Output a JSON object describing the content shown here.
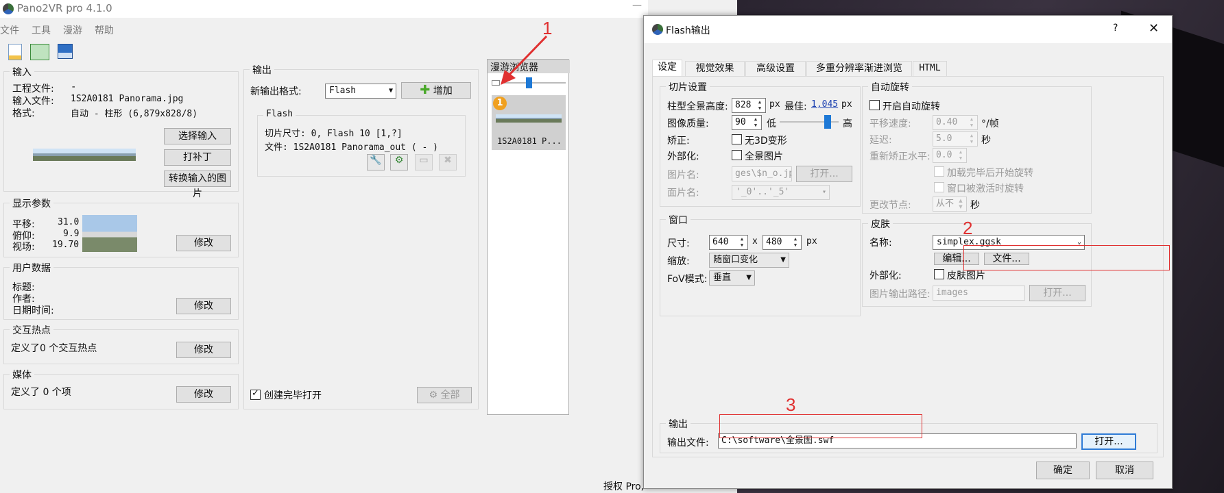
{
  "main_window": {
    "title": "Pano2VR pro 4.1.0",
    "menu": [
      "文件",
      "工具",
      "漫游",
      "帮助"
    ],
    "input_group": {
      "title": "输入",
      "project_file_label": "工程文件:",
      "project_file_value": "-",
      "input_file_label": "输入文件:",
      "input_file_value": "1S2A0181 Panorama.jpg",
      "format_label": "格式:",
      "format_value": "自动 - 柱形 (6,879x828/8)",
      "select_input_btn": "选择输入",
      "patch_btn": "打补丁",
      "convert_btn": "转换输入的图片"
    },
    "display_group": {
      "title": "显示参数",
      "pan_label": "平移:",
      "pan_value": "31.0",
      "tilt_label": "俯仰:",
      "tilt_value": "9.9",
      "fov_label": "视场:",
      "fov_value": "19.70",
      "modify_btn": "修改"
    },
    "userdata_group": {
      "title": "用户数据",
      "title_label": "标题:",
      "author_label": "作者:",
      "date_label": "日期时间:",
      "modify_btn": "修改"
    },
    "hotspot_group": {
      "title": "交互热点",
      "text": "定义了0 个交互热点",
      "modify_btn": "修改"
    },
    "media_group": {
      "title": "媒体",
      "text": "定义了 0 个项",
      "modify_btn": "修改"
    },
    "output_group": {
      "title": "输出",
      "new_format_label": "新输出格式:",
      "format_select": "Flash",
      "add_btn": "增加",
      "flash_title": "Flash",
      "tile_size": "切片尺寸: 0, Flash 10 [1,?]",
      "file_text": "文件: 1S2A0181 Panorama_out ( - )",
      "open_after_label": "创建完毕打开",
      "all_btn": "全部"
    },
    "browser": {
      "title": "漫游浏览器",
      "badge": "1",
      "item_label": "1S2A0181 P..."
    },
    "license_text": "授权 Pro,"
  },
  "dialog": {
    "title": "Flash输出",
    "help_btn": "?",
    "close_btn": "✕",
    "tabs": [
      "设定",
      "视觉效果",
      "高级设置",
      "多重分辨率渐进浏览",
      "HTML"
    ],
    "tile_group": {
      "title": "切片设置",
      "height_label": "柱型全景高度:",
      "height_value": "828",
      "px": "px",
      "best_label": "最佳:",
      "best_value": "1,045",
      "quality_label": "图像质量:",
      "quality_value": "90",
      "low": "低",
      "high": "高",
      "quality_level": 0.85,
      "correct_label": "矫正:",
      "no3d_label": "无3D变形",
      "external_label": "外部化:",
      "pano_image_label": "全景图片",
      "image_name_label": "图片名:",
      "image_name_value": "ges\\$n_o.jpg",
      "open_btn": "打开...",
      "face_name_label": "面片名:",
      "face_name_value": "'_0'..'_5'"
    },
    "autorotate_group": {
      "title": "自动旋转",
      "enable_label": "开启自动旋转",
      "speed_label": "平移速度:",
      "speed_value": "0.40",
      "speed_unit": "°/帧",
      "delay_label": "延迟:",
      "delay_value": "5.0",
      "delay_unit": "秒",
      "level_label": "重新矫正水平:",
      "level_value": "0.0",
      "after_load_label": "加载完毕后开始旋转",
      "activate_label": "窗口被激活时旋转",
      "change_node_label": "更改节点:",
      "change_node_value": "从不",
      "change_node_unit": "秒"
    },
    "window_group": {
      "title": "窗口",
      "size_label": "尺寸:",
      "width_value": "640",
      "x": "x",
      "height_value": "480",
      "px": "px",
      "scale_label": "缩放:",
      "scale_value": "随窗口变化",
      "fov_label": "FoV模式:",
      "fov_value": "垂直"
    },
    "skin_group": {
      "title": "皮肤",
      "name_label": "名称:",
      "name_value": "simplex.ggsk",
      "edit_btn": "编辑...",
      "file_btn": "文件...",
      "external_label": "外部化:",
      "skin_image_label": "皮肤图片",
      "path_label": "图片输出路径:",
      "path_value": "images",
      "open_btn": "打开..."
    },
    "output_group": {
      "title": "输出",
      "file_label": "输出文件:",
      "file_value": "C:\\software\\全景图.swf",
      "open_btn": "打开..."
    },
    "ok_btn": "确定",
    "cancel_btn": "取消"
  },
  "annotations": [
    "1",
    "2",
    "3"
  ],
  "colors": {
    "annotation_red": "#e03030",
    "focus_blue": "#2e7bd6",
    "link_blue": "#1a3fb0"
  }
}
